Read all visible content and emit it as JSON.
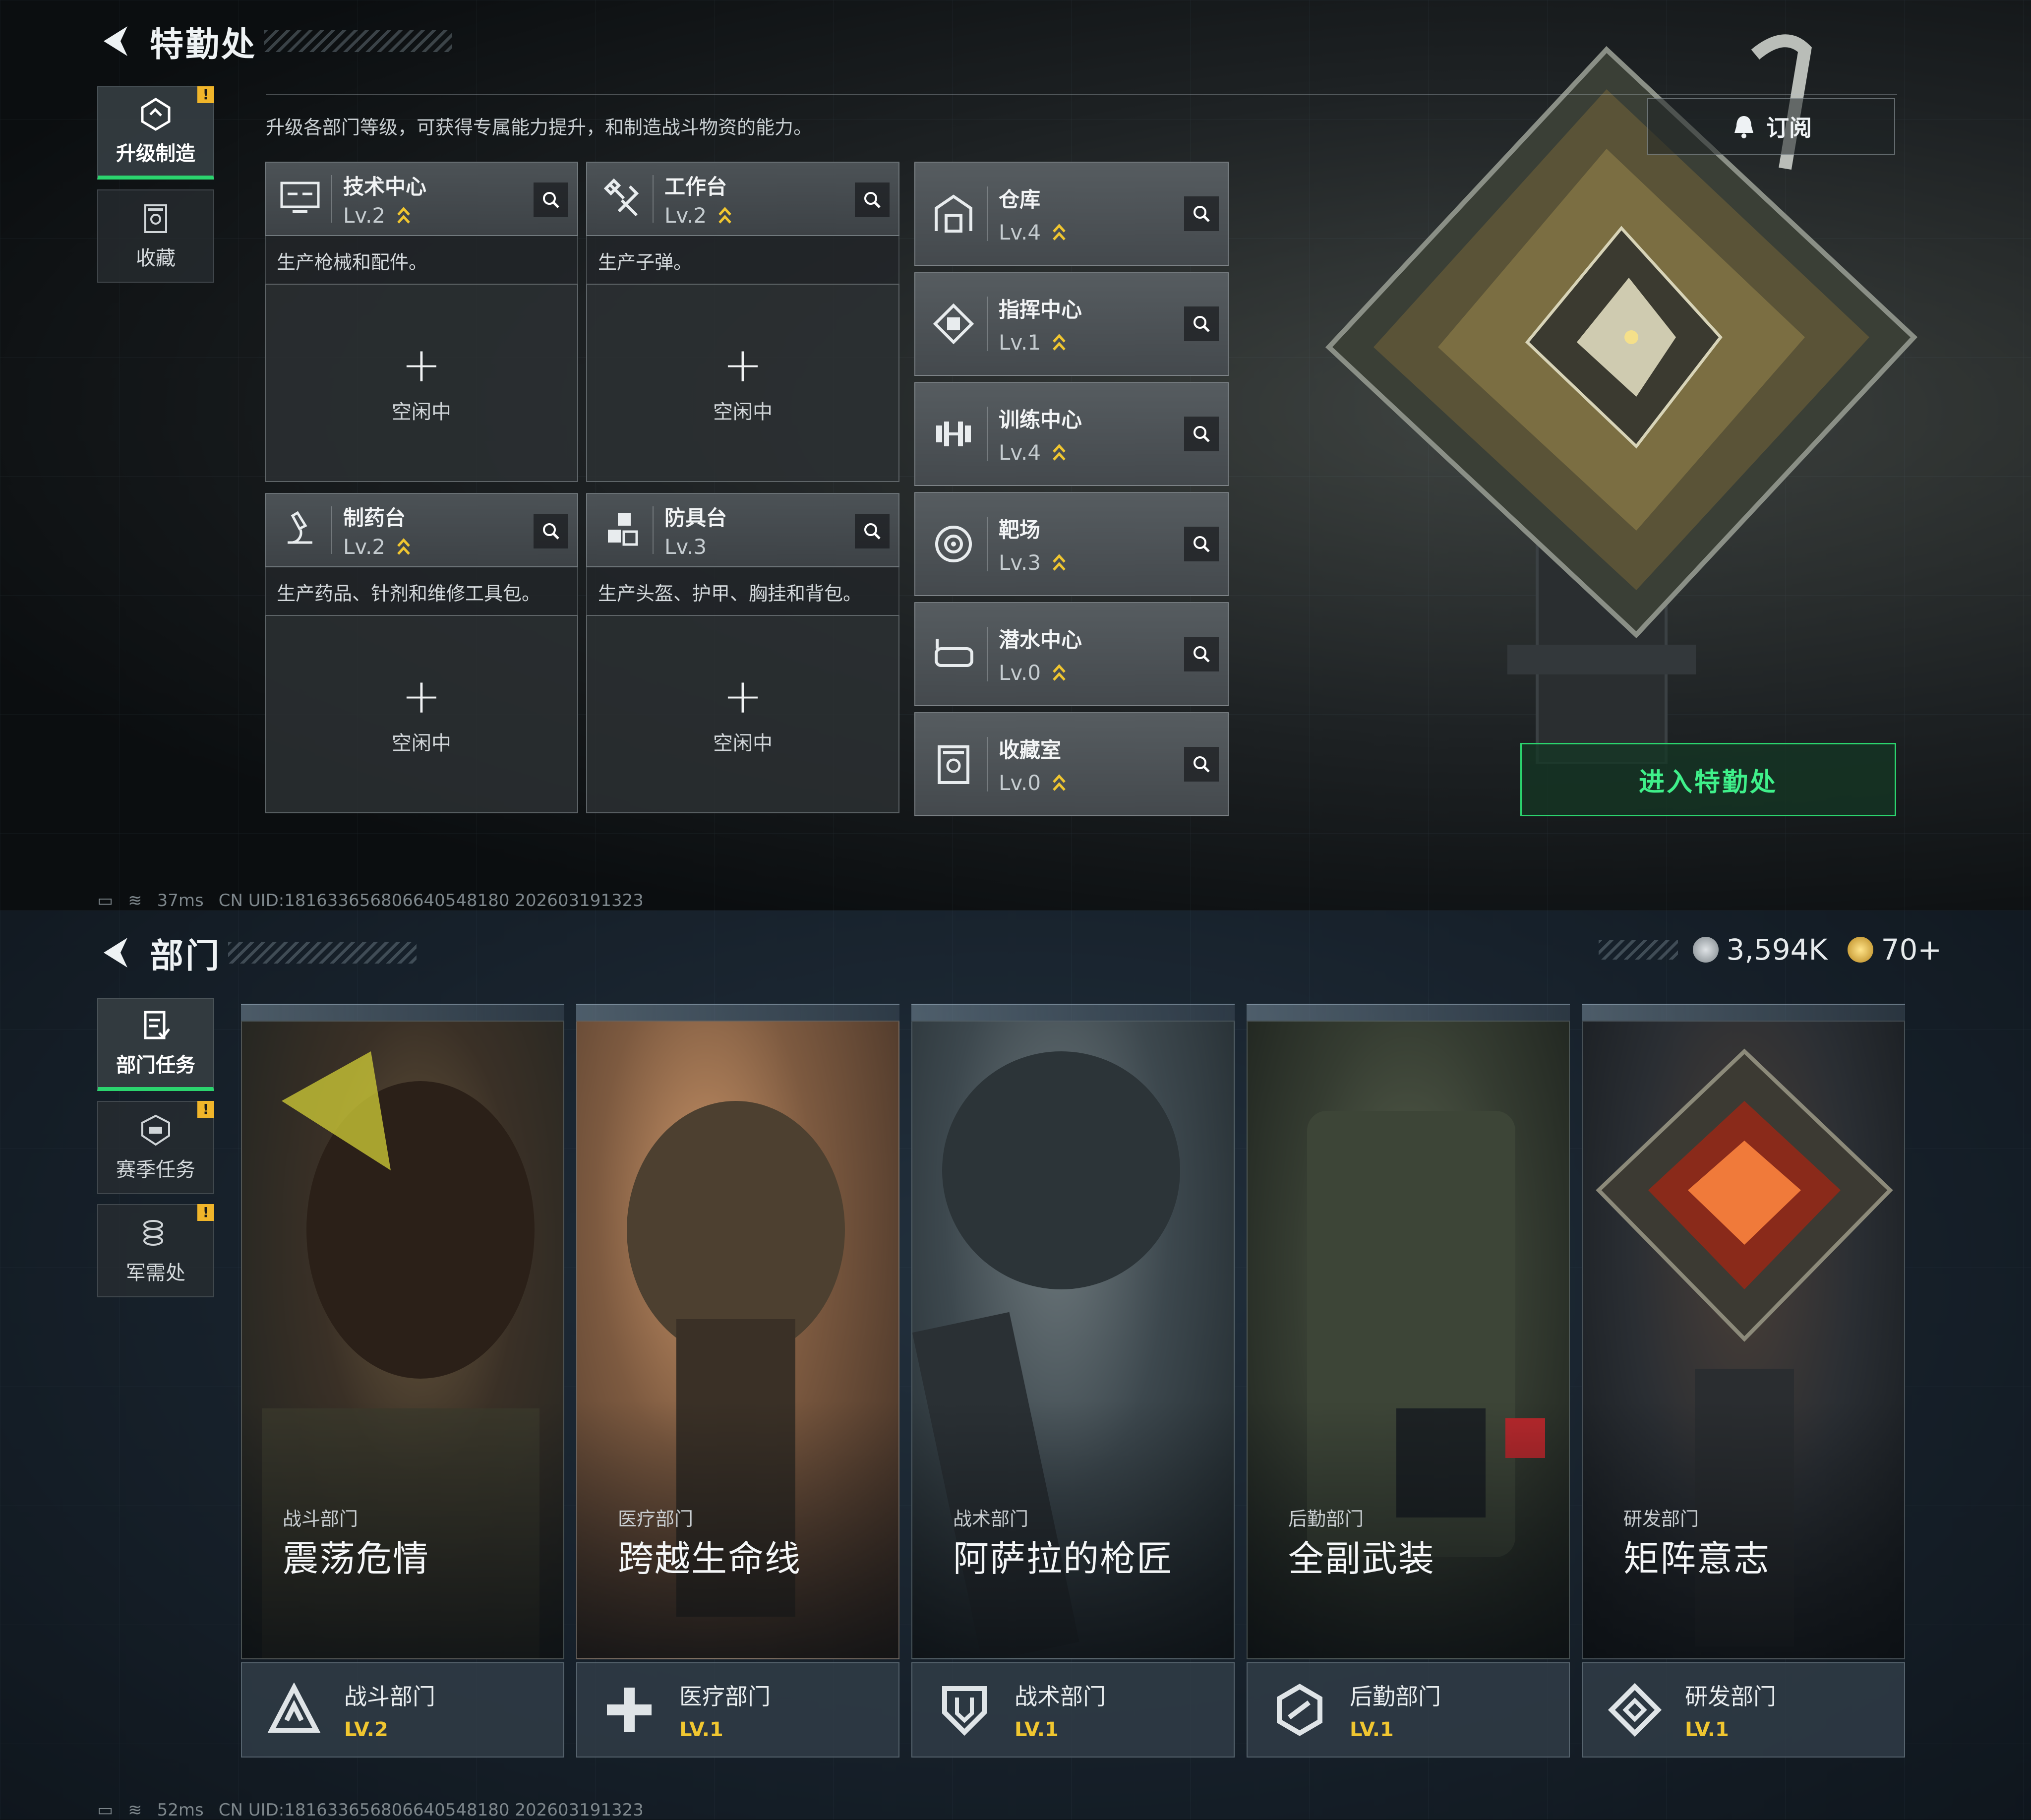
{
  "top": {
    "title": "特勤处",
    "tabs": [
      {
        "label": "升级制造",
        "badge": "!"
      },
      {
        "label": "收藏"
      }
    ],
    "description": "升级各部门等级，可获得专属能力提升，和制造战斗物资的能力。",
    "subscribe_label": "订阅",
    "benches": [
      {
        "name": "技术中心",
        "level": "Lv.2",
        "desc": "生产枪械和配件。",
        "slot_label": "空闲中",
        "icon": "monitor-icon"
      },
      {
        "name": "工作台",
        "level": "Lv.2",
        "desc": "生产子弹。",
        "slot_label": "空闲中",
        "icon": "hammer-icon"
      },
      {
        "name": "制药台",
        "level": "Lv.2",
        "desc": "生产药品、针剂和维修工具包。",
        "slot_label": "空闲中",
        "icon": "microscope-icon"
      },
      {
        "name": "防具台",
        "level": "Lv.3",
        "desc": "生产头盔、护甲、胸挂和背包。",
        "slot_label": "空闲中",
        "icon": "cubes-icon"
      }
    ],
    "departments": [
      {
        "name": "仓库",
        "level": "Lv.4",
        "icon": "warehouse-icon"
      },
      {
        "name": "指挥中心",
        "level": "Lv.1",
        "icon": "chip-icon"
      },
      {
        "name": "训练中心",
        "level": "Lv.4",
        "icon": "dumbbell-icon"
      },
      {
        "name": "靶场",
        "level": "Lv.3",
        "icon": "target-icon"
      },
      {
        "name": "潜水中心",
        "level": "Lv.0",
        "icon": "goggles-icon"
      },
      {
        "name": "收藏室",
        "level": "Lv.0",
        "icon": "trophy-case-icon"
      }
    ],
    "enter_label": "进入特勤处",
    "status": {
      "ping": "37ms",
      "uid": "CN UID:1816336568066405481​80 202603191323"
    }
  },
  "bottom": {
    "title": "部门",
    "tabs": [
      {
        "label": "部门任务"
      },
      {
        "label": "赛季任务",
        "badge": "!"
      },
      {
        "label": "军需处",
        "badge": "!"
      }
    ],
    "currency": [
      {
        "value": "3,594K",
        "icon": "silver-coin-icon"
      },
      {
        "value": "70+",
        "icon": "gold-coin-icon"
      }
    ],
    "cards": [
      {
        "subtitle": "战斗部门",
        "title": "震荡危情",
        "dept": "战斗部门",
        "level": "LV.2"
      },
      {
        "subtitle": "医疗部门",
        "title": "跨越生命线",
        "dept": "医疗部门",
        "level": "LV.1"
      },
      {
        "subtitle": "战术部门",
        "title": "阿萨拉的枪匠",
        "dept": "战术部门",
        "level": "LV.1"
      },
      {
        "subtitle": "后勤部门",
        "title": "全副武装",
        "dept": "后勤部门",
        "level": "LV.1"
      },
      {
        "subtitle": "研发部门",
        "title": "矩阵意志",
        "dept": "研发部门",
        "level": "LV.1"
      }
    ],
    "status": {
      "ping": "52ms",
      "uid": "CN UID:1816336568066405481​80 202603191323"
    }
  },
  "colors": {
    "accent_green": "#2bd46e",
    "level_gold": "#f0c630",
    "badge_yellow": "#f0b52a"
  }
}
